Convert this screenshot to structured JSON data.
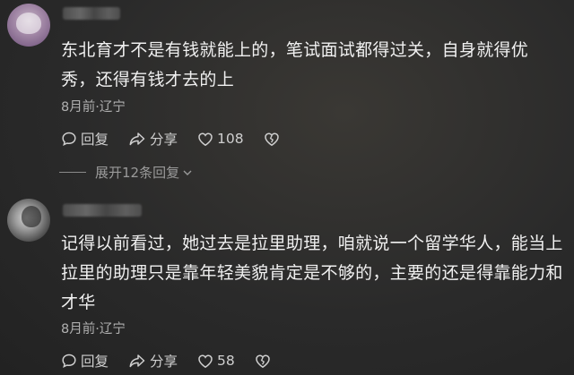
{
  "comments": [
    {
      "text": "东北育才不是有钱就能上的，笔试面试都得过关，自身就得优秀，还得有钱才去的上",
      "meta": "8月前·辽宁",
      "reply_label": "回复",
      "share_label": "分享",
      "like_count": "108"
    },
    {
      "text": "记得以前看过，她过去是拉里助理，咱就说一个留学华人，能当上拉里的助理只是靠年轻美貌肯定是不够的，主要的还是得靠能力和才华",
      "meta": "8月前·辽宁",
      "reply_label": "回复",
      "share_label": "分享",
      "like_count": "58"
    }
  ],
  "expand_replies": "展开12条回复",
  "icons": {
    "reply": "comment-bubble-icon",
    "share": "share-arrow-icon",
    "like": "heart-icon",
    "dislike": "broken-heart-icon",
    "expand": "chevron-down-icon"
  },
  "colors": {
    "background": "#2b2b2b",
    "text": "#f0f0f0",
    "muted": "#b0b0b0"
  }
}
